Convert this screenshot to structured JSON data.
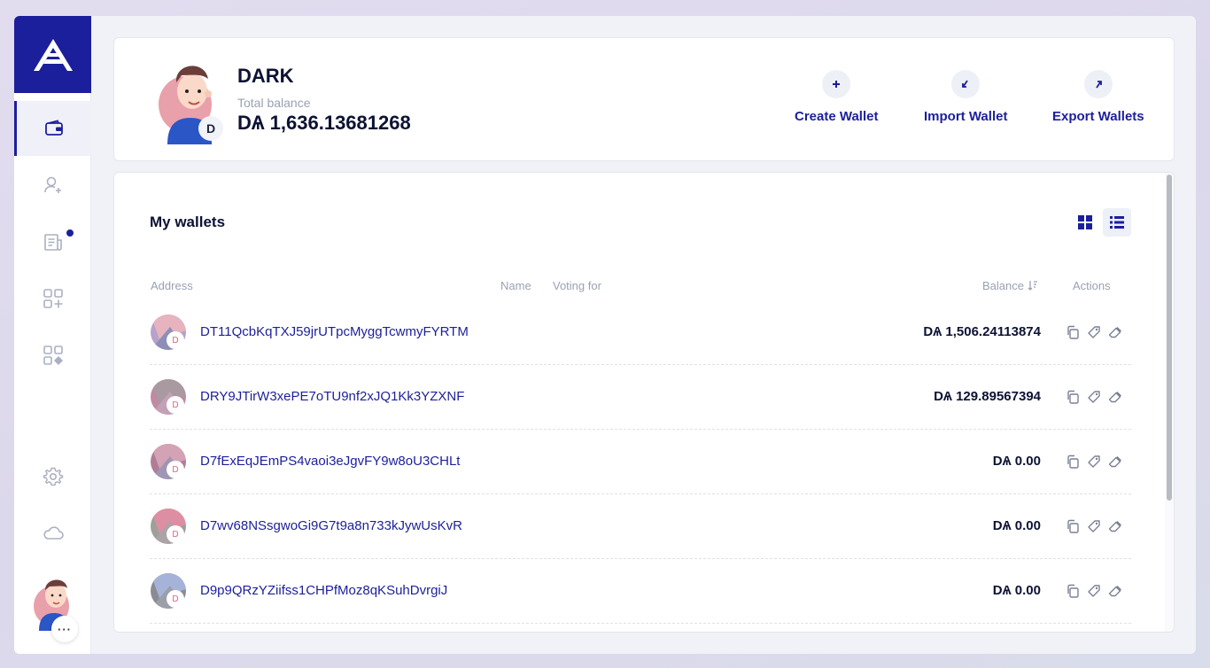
{
  "profile": {
    "name": "DARK",
    "total_balance_label": "Total balance",
    "total_balance": "DѦ 1,636.13681268",
    "avatar_badge": "D"
  },
  "header_actions": [
    {
      "label": "Create Wallet",
      "icon": "plus-icon"
    },
    {
      "label": "Import Wallet",
      "icon": "import-arrow-icon"
    },
    {
      "label": "Export Wallets",
      "icon": "export-arrow-icon"
    }
  ],
  "sidebar": {
    "items": [
      {
        "name": "wallets",
        "icon": "wallet-icon",
        "active": true
      },
      {
        "name": "contacts",
        "icon": "add-contact-icon"
      },
      {
        "name": "announcements",
        "icon": "document-icon",
        "has_notification": true
      },
      {
        "name": "plugins",
        "icon": "add-apps-icon"
      },
      {
        "name": "plugin-manager",
        "icon": "apps-icon"
      },
      {
        "name": "settings",
        "icon": "gear-icon"
      },
      {
        "name": "network",
        "icon": "cloud-icon"
      }
    ],
    "more_label": "···"
  },
  "wallets": {
    "title": "My wallets",
    "columns": {
      "address": "Address",
      "name": "Name",
      "voting_for": "Voting for",
      "balance": "Balance",
      "actions": "Actions"
    },
    "rows": [
      {
        "address": "DT11QcbKqTXJ59jrUTpcMyggTcwmyFYRTM",
        "balance": "DѦ 1,506.24113874",
        "badge": "D"
      },
      {
        "address": "DRY9JTirW3xePE7oTU9nf2xJQ1Kk3YZXNF",
        "balance": "DѦ 129.89567394",
        "badge": "D"
      },
      {
        "address": "D7fExEqJEmPS4vaoi3eJgvFY9w8oU3CHLt",
        "balance": "DѦ 0.00",
        "badge": "D"
      },
      {
        "address": "D7wv68NSsgwoGi9G7t9a8n733kJywUsKvR",
        "balance": "DѦ 0.00",
        "badge": "D"
      },
      {
        "address": "D9p9QRzYZiifss1CHPfMoz8qKSuhDvrgiJ",
        "balance": "DѦ 0.00",
        "badge": "D"
      }
    ]
  },
  "colors": {
    "accent": "#1c1f9b",
    "text_dark": "#0c1233",
    "muted": "#9aa1b4"
  }
}
